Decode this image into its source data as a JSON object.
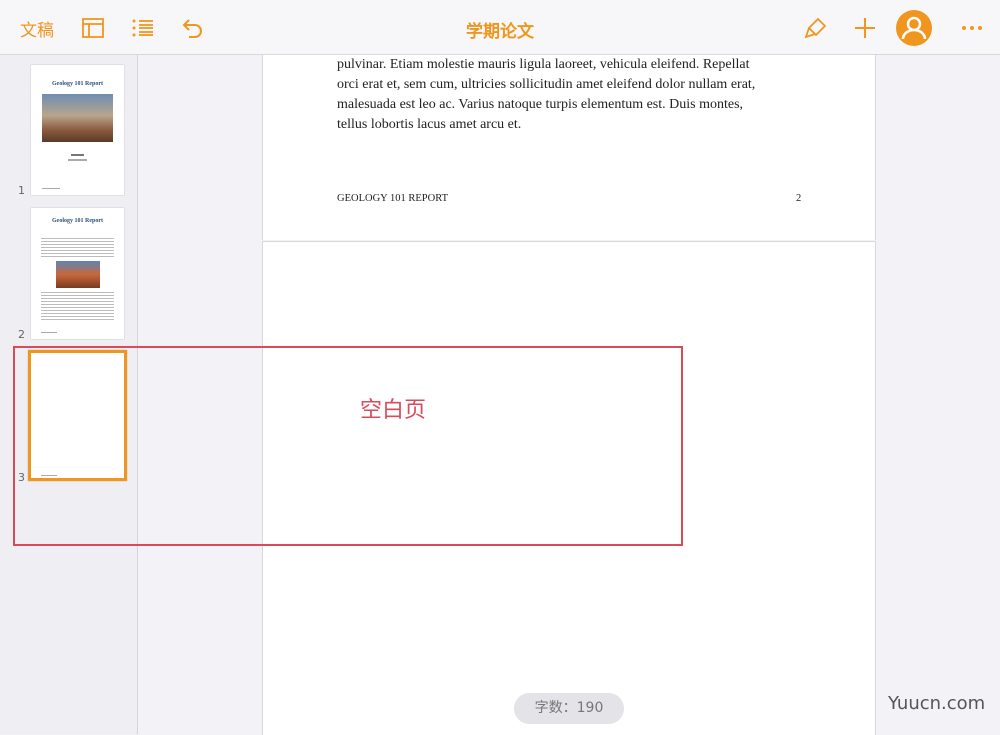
{
  "toolbar": {
    "docs_label": "文稿",
    "title": "学期论文"
  },
  "thumbnails": [
    {
      "number": "1",
      "heading": "Geology 101 Report"
    },
    {
      "number": "2",
      "heading": "Geology 101 Report"
    },
    {
      "number": "3",
      "heading": ""
    }
  ],
  "page": {
    "body_lines": [
      "pulvinar. Etiam molestie mauris ligula laoreet, vehicula eleifend. Repellat",
      "orci erat et, sem cum, ultricies sollicitudin amet eleifend dolor nullam erat,",
      "malesuada est leo ac. Varius natoque turpis elementum est. Duis montes,",
      "tellus lobortis lacus amet arcu et."
    ],
    "footer_title": "GEOLOGY 101 REPORT",
    "footer_page": "2"
  },
  "annotation": {
    "label": "空白页"
  },
  "status": {
    "word_count": "字数：190"
  },
  "watermark": "Yuucn.com",
  "colors": {
    "accent": "#f0961e",
    "annotation": "#d84b5a"
  }
}
